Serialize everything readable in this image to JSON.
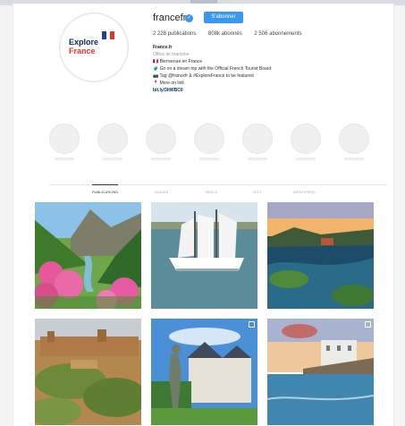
{
  "profile": {
    "logo_line1": "Explore",
    "logo_line2": "France",
    "username": "francefr",
    "follow_label": "S'abonner",
    "stats": {
      "publications": "2 228 publications",
      "followers": "808k abonnés",
      "following": "2 506 abonnements"
    },
    "bio": {
      "name": "France.fr",
      "category": "Office de tourisme",
      "line1": "🇫🇷 Bienvenue en France",
      "line2": "🧳 Go on a dream trip with the Official French Tourist Board",
      "line3": "📷 Tag @francefr & #ExploreFrance to be featured",
      "line4": "📍 More on link",
      "link": "bit.ly/3ItWBC0"
    }
  },
  "tabs": [
    "PUBLICATIONS",
    "GUIDES",
    "REELS",
    "IGTV",
    "IDENTIFIÉ(E)"
  ],
  "colors": {
    "accent": "#3897f0",
    "flag_blue": "#1d3f94",
    "flag_white": "#ffffff",
    "flag_red": "#e1342c"
  },
  "icons": {
    "verified": "verified-badge-icon",
    "multi_post": "carousel-icon"
  }
}
